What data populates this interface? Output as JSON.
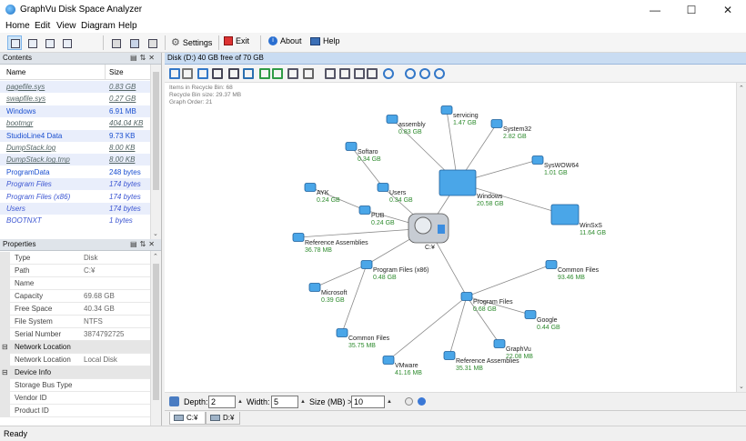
{
  "app": {
    "title": "GraphVu Disk Space Analyzer"
  },
  "menu": [
    "Home",
    "Edit",
    "View",
    "Diagram",
    "Help"
  ],
  "toolbar": {
    "settings": "Settings",
    "exit": "Exit",
    "about": "About",
    "help": "Help"
  },
  "contents": {
    "title": "Contents",
    "columns": [
      "Name",
      "Size"
    ],
    "rows": [
      {
        "name": "pagefile.sys",
        "size": "0.83 GB"
      },
      {
        "name": "swapfile.sys",
        "size": "0.27 GB"
      },
      {
        "name": "Windows",
        "size": "6.91 MB"
      },
      {
        "name": "bootmgr",
        "size": "404.04 KB"
      },
      {
        "name": "StudioLine4 Data",
        "size": "9.73 KB"
      },
      {
        "name": "DumpStack.log",
        "size": "8.00 KB"
      },
      {
        "name": "DumpStack.log.tmp",
        "size": "8.00 KB"
      },
      {
        "name": "ProgramData",
        "size": "248 bytes"
      },
      {
        "name": "Program Files",
        "size": "174 bytes"
      },
      {
        "name": "Program Files (x86)",
        "size": "174 bytes"
      },
      {
        "name": "Users",
        "size": "174 bytes"
      },
      {
        "name": "BOOTNXT",
        "size": "1 bytes"
      }
    ]
  },
  "properties": {
    "title": "Properties",
    "rows": [
      {
        "k": "Type",
        "v": "Disk"
      },
      {
        "k": "Path",
        "v": "C:¥"
      },
      {
        "k": "Name",
        "v": ""
      },
      {
        "k": "Capacity",
        "v": "69.68 GB"
      },
      {
        "k": "Free Space",
        "v": "40.34 GB"
      },
      {
        "k": "File System",
        "v": "NTFS"
      },
      {
        "k": "Serial Number",
        "v": "3874792725"
      },
      {
        "k": "Network Location",
        "v": "",
        "cat": true
      },
      {
        "k": "Network Location",
        "v": "Local Disk"
      },
      {
        "k": "Device Info",
        "v": "",
        "cat": true
      },
      {
        "k": "Storage Bus Type",
        "v": ""
      },
      {
        "k": "Vendor ID",
        "v": ""
      },
      {
        "k": "Product ID",
        "v": ""
      }
    ]
  },
  "diagram": {
    "header": "Disk (D:)    40 GB free of 70 GB",
    "info": [
      "Items in Recycle Bin: 68",
      "Recycle Bin size: 29.37 MB",
      "Graph Order: 21"
    ],
    "nodes": [
      {
        "name": "C:¥",
        "size": ""
      },
      {
        "name": "Windows",
        "size": "20.58 GB"
      },
      {
        "name": "WinSxS",
        "size": "11.64 GB"
      },
      {
        "name": "servicing",
        "size": "1.47 GB"
      },
      {
        "name": "System32",
        "size": "2.82 GB"
      },
      {
        "name": "SysWOW64",
        "size": "1.01 GB"
      },
      {
        "name": "assembly",
        "size": "0.83 GB"
      },
      {
        "name": "Softaro",
        "size": "0.34 GB"
      },
      {
        "name": "Users",
        "size": "0.34 GB"
      },
      {
        "name": "PUB",
        "size": "0.24 GB"
      },
      {
        "name": "AYK",
        "size": "0.24 GB"
      },
      {
        "name": "Reference Assemblies",
        "size": "36.78 MB"
      },
      {
        "name": "Program Files (x86)",
        "size": "0.48 GB"
      },
      {
        "name": "Microsoft",
        "size": "0.39 GB"
      },
      {
        "name": "Common Files",
        "size": "35.75 MB"
      },
      {
        "name": "Program Files",
        "size": "0.68 GB"
      },
      {
        "name": "Common Files",
        "size": "93.46 MB"
      },
      {
        "name": "Google",
        "size": "0.44 GB"
      },
      {
        "name": "GraphVu",
        "size": "22.08 MB"
      },
      {
        "name": "Reference Assemblies",
        "size": "35.31 MB"
      },
      {
        "name": "VMware",
        "size": "41.16 MB"
      }
    ]
  },
  "controls": {
    "depth_label": "Depth:",
    "depth": "2",
    "width_label": "Width:",
    "width": "5",
    "size_label": "Size (MB) >",
    "size": "10"
  },
  "tabs": [
    "C:¥",
    "D:¥"
  ],
  "status": "Ready"
}
